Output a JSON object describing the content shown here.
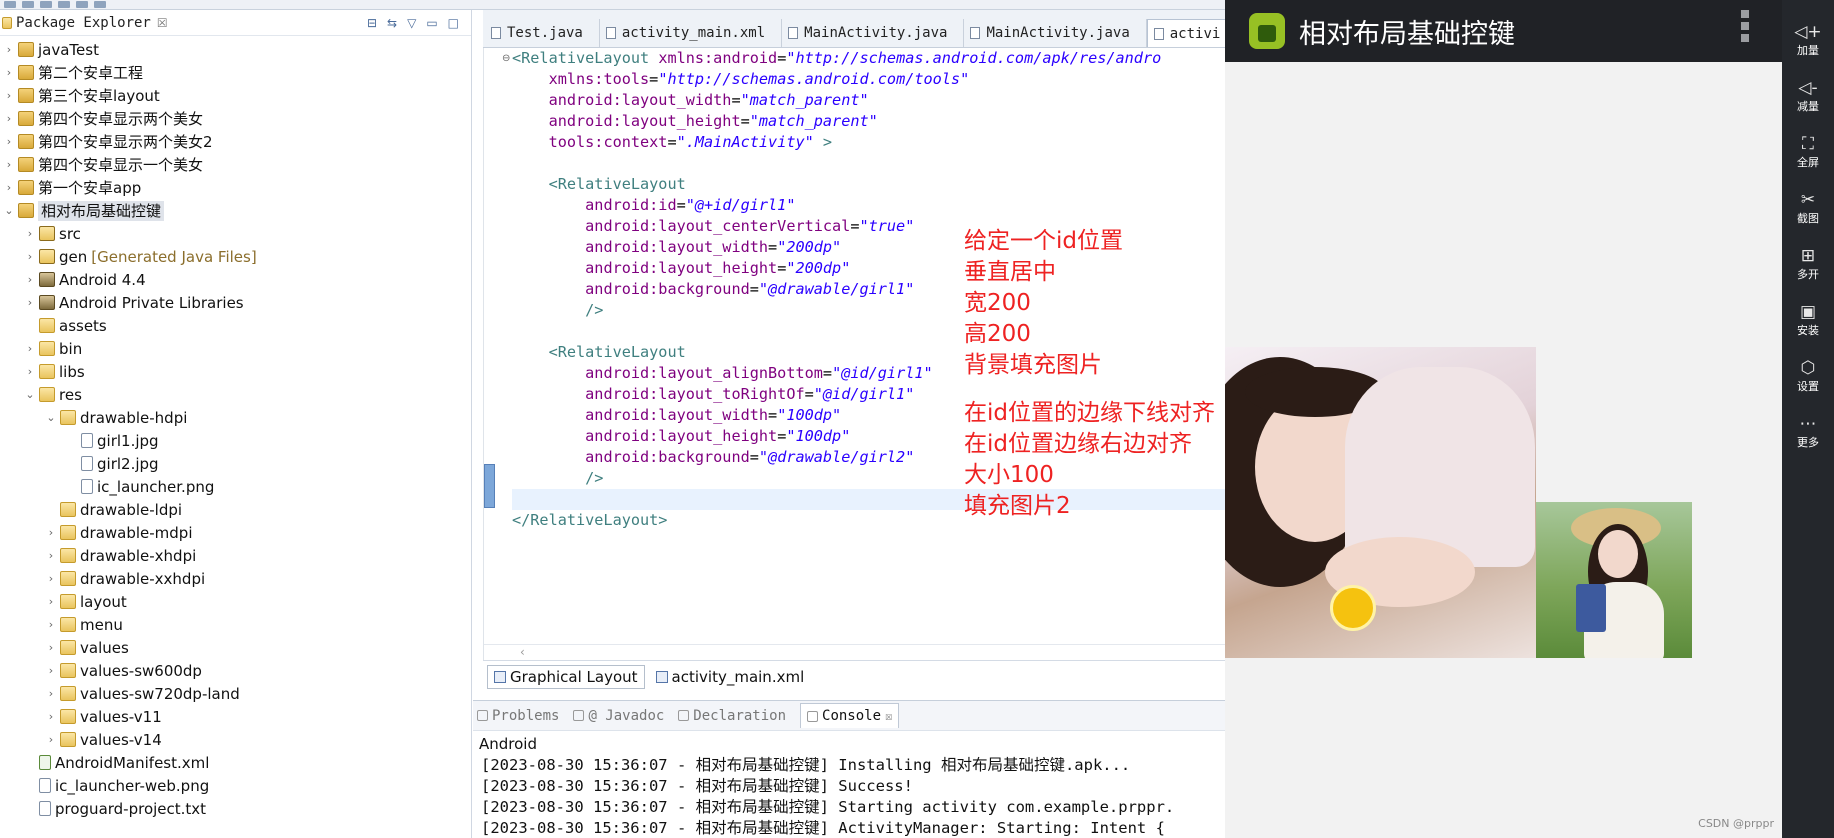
{
  "explorer": {
    "title": "Package Explorer",
    "close": "☒",
    "items": [
      {
        "label": "javaTest",
        "level": 0,
        "twisty": "›",
        "icon": "project-icon",
        "decoration": ""
      },
      {
        "label": "第二个安卓工程",
        "level": 0,
        "twisty": "›",
        "icon": "project-icon",
        "decoration": ""
      },
      {
        "label": "第三个安卓layout",
        "level": 0,
        "twisty": "›",
        "icon": "project-icon",
        "decoration": ""
      },
      {
        "label": "第四个安卓显示两个美女",
        "level": 0,
        "twisty": "›",
        "icon": "project-icon",
        "decoration": ""
      },
      {
        "label": "第四个安卓显示两个美女2",
        "level": 0,
        "twisty": "›",
        "icon": "project-icon",
        "decoration": ""
      },
      {
        "label": "第四个安卓显示一个美女",
        "level": 0,
        "twisty": "›",
        "icon": "project-icon",
        "decoration": ""
      },
      {
        "label": "第一个安卓app",
        "level": 0,
        "twisty": "›",
        "icon": "project-icon",
        "decoration": ""
      },
      {
        "label": "相对布局基础控键",
        "level": 0,
        "twisty": "⌄",
        "icon": "project-icon",
        "decoration": "",
        "selected": true
      },
      {
        "label": "src",
        "level": 1,
        "twisty": "›",
        "icon": "source-folder-icon",
        "decoration": ""
      },
      {
        "label": "gen",
        "level": 1,
        "twisty": "›",
        "icon": "source-folder-icon",
        "decoration": "[Generated Java Files]"
      },
      {
        "label": "Android 4.4",
        "level": 1,
        "twisty": "›",
        "icon": "library-icon",
        "decoration": ""
      },
      {
        "label": "Android Private Libraries",
        "level": 1,
        "twisty": "›",
        "icon": "library-icon",
        "decoration": ""
      },
      {
        "label": "assets",
        "level": 1,
        "twisty": "",
        "icon": "folder-icon",
        "decoration": ""
      },
      {
        "label": "bin",
        "level": 1,
        "twisty": "›",
        "icon": "folder-icon",
        "decoration": ""
      },
      {
        "label": "libs",
        "level": 1,
        "twisty": "›",
        "icon": "folder-icon",
        "decoration": ""
      },
      {
        "label": "res",
        "level": 1,
        "twisty": "⌄",
        "icon": "folder-icon",
        "decoration": ""
      },
      {
        "label": "drawable-hdpi",
        "level": 2,
        "twisty": "⌄",
        "icon": "folder-icon",
        "decoration": ""
      },
      {
        "label": "girl1.jpg",
        "level": 3,
        "twisty": "",
        "icon": "file-icon",
        "decoration": ""
      },
      {
        "label": "girl2.jpg",
        "level": 3,
        "twisty": "",
        "icon": "file-icon",
        "decoration": ""
      },
      {
        "label": "ic_launcher.png",
        "level": 3,
        "twisty": "",
        "icon": "file-icon",
        "decoration": ""
      },
      {
        "label": "drawable-ldpi",
        "level": 2,
        "twisty": "",
        "icon": "folder-icon",
        "decoration": ""
      },
      {
        "label": "drawable-mdpi",
        "level": 2,
        "twisty": "›",
        "icon": "folder-icon",
        "decoration": ""
      },
      {
        "label": "drawable-xhdpi",
        "level": 2,
        "twisty": "›",
        "icon": "folder-icon",
        "decoration": ""
      },
      {
        "label": "drawable-xxhdpi",
        "level": 2,
        "twisty": "›",
        "icon": "folder-icon",
        "decoration": ""
      },
      {
        "label": "layout",
        "level": 2,
        "twisty": "›",
        "icon": "folder-icon",
        "decoration": ""
      },
      {
        "label": "menu",
        "level": 2,
        "twisty": "›",
        "icon": "folder-icon",
        "decoration": ""
      },
      {
        "label": "values",
        "level": 2,
        "twisty": "›",
        "icon": "folder-icon",
        "decoration": ""
      },
      {
        "label": "values-sw600dp",
        "level": 2,
        "twisty": "›",
        "icon": "folder-icon",
        "decoration": ""
      },
      {
        "label": "values-sw720dp-land",
        "level": 2,
        "twisty": "›",
        "icon": "folder-icon",
        "decoration": ""
      },
      {
        "label": "values-v11",
        "level": 2,
        "twisty": "›",
        "icon": "folder-icon",
        "decoration": ""
      },
      {
        "label": "values-v14",
        "level": 2,
        "twisty": "›",
        "icon": "folder-icon",
        "decoration": ""
      },
      {
        "label": "AndroidManifest.xml",
        "level": 1,
        "twisty": "",
        "icon": "xml-file-icon",
        "decoration": ""
      },
      {
        "label": "ic_launcher-web.png",
        "level": 1,
        "twisty": "",
        "icon": "file-icon",
        "decoration": ""
      },
      {
        "label": "proguard-project.txt",
        "level": 1,
        "twisty": "",
        "icon": "file-icon",
        "decoration": ""
      }
    ]
  },
  "editor": {
    "tabs": [
      {
        "label": "Test.java",
        "active": false
      },
      {
        "label": "activity_main.xml",
        "active": false
      },
      {
        "label": "MainActivity.java",
        "active": false
      },
      {
        "label": "MainActivity.java",
        "active": false
      },
      {
        "label": "activi",
        "active": true
      }
    ],
    "code_lines": [
      [
        {
          "t": "tag",
          "s": "<RelativeLayout "
        },
        {
          "t": "attr",
          "s": "xmlns:android"
        },
        {
          "t": "plain",
          "s": "="
        },
        {
          "t": "val",
          "s": "\"http://schemas.android.com/apk/res/andro"
        }
      ],
      [
        {
          "t": "plain",
          "s": "    "
        },
        {
          "t": "attr",
          "s": "xmlns:tools"
        },
        {
          "t": "plain",
          "s": "="
        },
        {
          "t": "val",
          "s": "\"http://schemas.android.com/tools\""
        }
      ],
      [
        {
          "t": "plain",
          "s": "    "
        },
        {
          "t": "attr",
          "s": "android:layout_width"
        },
        {
          "t": "plain",
          "s": "="
        },
        {
          "t": "val",
          "s": "\"match_parent\""
        }
      ],
      [
        {
          "t": "plain",
          "s": "    "
        },
        {
          "t": "attr",
          "s": "android:layout_height"
        },
        {
          "t": "plain",
          "s": "="
        },
        {
          "t": "val",
          "s": "\"match_parent\""
        }
      ],
      [
        {
          "t": "plain",
          "s": "    "
        },
        {
          "t": "attr",
          "s": "tools:context"
        },
        {
          "t": "plain",
          "s": "="
        },
        {
          "t": "val",
          "s": "\".MainActivity\""
        },
        {
          "t": "tag",
          "s": " >"
        }
      ],
      [],
      [
        {
          "t": "plain",
          "s": "    "
        },
        {
          "t": "tag",
          "s": "<RelativeLayout"
        }
      ],
      [
        {
          "t": "plain",
          "s": "        "
        },
        {
          "t": "attr",
          "s": "android:id"
        },
        {
          "t": "plain",
          "s": "="
        },
        {
          "t": "val",
          "s": "\"@+id/girl1\""
        }
      ],
      [
        {
          "t": "plain",
          "s": "        "
        },
        {
          "t": "attr",
          "s": "android:layout_centerVertical"
        },
        {
          "t": "plain",
          "s": "="
        },
        {
          "t": "val",
          "s": "\"true\""
        }
      ],
      [
        {
          "t": "plain",
          "s": "        "
        },
        {
          "t": "attr",
          "s": "android:layout_width"
        },
        {
          "t": "plain",
          "s": "="
        },
        {
          "t": "val",
          "s": "\"200dp\""
        }
      ],
      [
        {
          "t": "plain",
          "s": "        "
        },
        {
          "t": "attr",
          "s": "android:layout_height"
        },
        {
          "t": "plain",
          "s": "="
        },
        {
          "t": "val",
          "s": "\"200dp\""
        }
      ],
      [
        {
          "t": "plain",
          "s": "        "
        },
        {
          "t": "attr",
          "s": "android:background"
        },
        {
          "t": "plain",
          "s": "="
        },
        {
          "t": "val",
          "s": "\"@drawable/girl1\""
        }
      ],
      [
        {
          "t": "plain",
          "s": "        "
        },
        {
          "t": "tag",
          "s": "/>"
        }
      ],
      [],
      [
        {
          "t": "plain",
          "s": "    "
        },
        {
          "t": "tag",
          "s": "<RelativeLayout"
        }
      ],
      [
        {
          "t": "plain",
          "s": "        "
        },
        {
          "t": "attr",
          "s": "android:layout_alignBottom"
        },
        {
          "t": "plain",
          "s": "="
        },
        {
          "t": "val",
          "s": "\"@id/girl1\""
        }
      ],
      [
        {
          "t": "plain",
          "s": "        "
        },
        {
          "t": "attr",
          "s": "android:layout_toRightOf"
        },
        {
          "t": "plain",
          "s": "="
        },
        {
          "t": "val",
          "s": "\"@id/girl1\""
        }
      ],
      [
        {
          "t": "plain",
          "s": "        "
        },
        {
          "t": "attr",
          "s": "android:layout_width"
        },
        {
          "t": "plain",
          "s": "="
        },
        {
          "t": "val",
          "s": "\"100dp\""
        }
      ],
      [
        {
          "t": "plain",
          "s": "        "
        },
        {
          "t": "attr",
          "s": "android:layout_height"
        },
        {
          "t": "plain",
          "s": "="
        },
        {
          "t": "val",
          "s": "\"100dp\""
        }
      ],
      [
        {
          "t": "plain",
          "s": "        "
        },
        {
          "t": "attr",
          "s": "android:background"
        },
        {
          "t": "plain",
          "s": "="
        },
        {
          "t": "val",
          "s": "\"@drawable/girl2\""
        }
      ],
      [
        {
          "t": "plain",
          "s": "        "
        },
        {
          "t": "tag",
          "s": "/>"
        }
      ],
      [],
      [
        {
          "t": "tag",
          "s": "</RelativeLayout>"
        }
      ]
    ],
    "annotations_1": [
      "给定一个id位置",
      "垂直居中",
      "宽200",
      "高200",
      "背景填充图片"
    ],
    "annotations_2": [
      "在id位置的边缘下线对齐",
      "在id位置边缘右边对齐",
      "大小100",
      "填充图片2"
    ],
    "scroll_arrow": "‹",
    "bottom_tabs": [
      {
        "label": "Graphical Layout",
        "active": true
      },
      {
        "label": "activity_main.xml",
        "active": false
      }
    ]
  },
  "console": {
    "tabs": [
      {
        "label": "Problems",
        "active": false
      },
      {
        "label": "@ Javadoc",
        "active": false
      },
      {
        "label": "Declaration",
        "active": false
      },
      {
        "label": "Console",
        "active": true,
        "close": "☒"
      }
    ],
    "name": "Android",
    "lines": [
      "[2023-08-30 15:36:07 - 相对布局基础控键] Installing 相对布局基础控键.apk...",
      "[2023-08-30 15:36:07 - 相对布局基础控键] Success!",
      "[2023-08-30 15:36:07 - 相对布局基础控键] Starting activity com.example.prppr.",
      "[2023-08-30 15:36:07 - 相对布局基础控键] ActivityManager: Starting: Intent {"
    ]
  },
  "emulator": {
    "title": "相对布局基础控键",
    "controls": [
      {
        "label": "加量",
        "glyph": "◁+",
        "icon": "volume-up-icon"
      },
      {
        "label": "减量",
        "glyph": "◁-",
        "icon": "volume-down-icon"
      },
      {
        "label": "全屏",
        "glyph": "⛶",
        "icon": "fullscreen-icon"
      },
      {
        "label": "截图",
        "glyph": "✂",
        "icon": "scissors-icon"
      },
      {
        "label": "多开",
        "glyph": "⊞",
        "icon": "multi-instance-icon"
      },
      {
        "label": "安装",
        "glyph": "▣",
        "icon": "apk-install-icon"
      },
      {
        "label": "设置",
        "glyph": "⬡",
        "icon": "settings-icon"
      },
      {
        "label": "更多",
        "glyph": "⋯",
        "icon": "more-icon"
      }
    ],
    "watermark": "CSDN @prppr"
  }
}
